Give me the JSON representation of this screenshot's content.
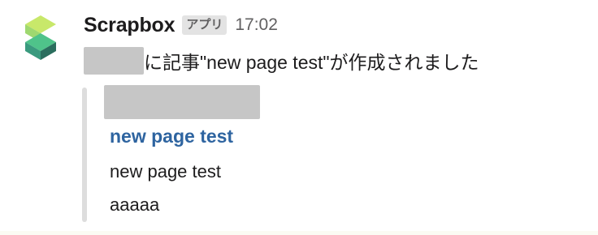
{
  "message": {
    "sender": "Scrapbox",
    "app_badge": "アプリ",
    "timestamp": "17:02",
    "text": "に記事\"new page test\"が作成されました"
  },
  "attachment": {
    "title": "new page test",
    "lines": [
      "new page test",
      "aaaaa"
    ]
  },
  "icons": {
    "avatar": "scrapbox-logo-icon"
  },
  "colors": {
    "link": "#2e64a0",
    "logo_light_green": "#c8e86a",
    "logo_green": "#4fc38a",
    "logo_dark_green": "#2b6e5e"
  }
}
